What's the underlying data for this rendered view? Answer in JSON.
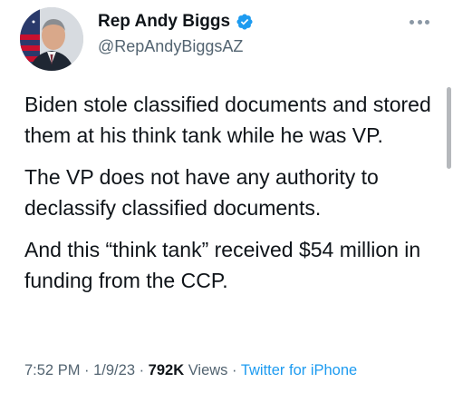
{
  "author": {
    "display_name": "Rep Andy Biggs",
    "handle": "@RepAndyBiggsAZ",
    "avatar_icon": "user-avatar-photo",
    "verified_icon": "verified-badge-icon",
    "verified_color": "#1d9bf0"
  },
  "tweet": {
    "paragraphs": [
      "Biden stole classified documents and stored them at his think tank while he was VP.",
      "The VP does not have any authority to declassify classified documents.",
      "And this “think tank” received $54 million in funding from the CCP."
    ]
  },
  "meta": {
    "time": "7:52 PM",
    "sep1": " · ",
    "date": "1/9/23",
    "sep2": " · ",
    "views_count": "792K",
    "views_label": " Views",
    "sep3": " · ",
    "source": "Twitter for iPhone"
  },
  "colors": {
    "text": "#0f1419",
    "secondary": "#536471",
    "link": "#1d9bf0"
  }
}
